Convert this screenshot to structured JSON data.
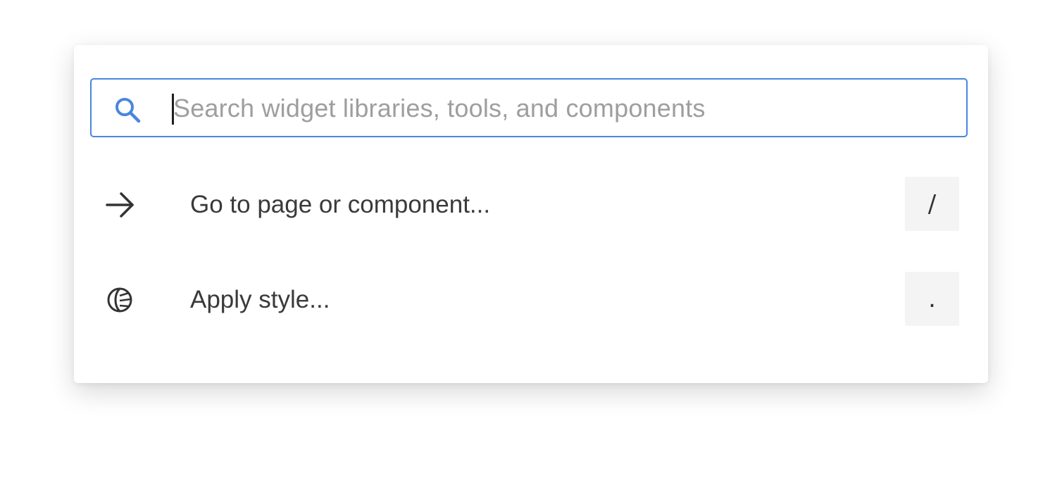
{
  "search": {
    "placeholder": "Search widget libraries, tools, and components",
    "value": ""
  },
  "commands": [
    {
      "icon": "arrow-right-icon",
      "label": "Go to page or component...",
      "shortcut": "/"
    },
    {
      "icon": "style-leaf-icon",
      "label": "Apply style...",
      "shortcut": "."
    }
  ],
  "colors": {
    "accent": "#4a86dd",
    "text": "#3a3a3a",
    "placeholder": "#9e9e9e",
    "kbd_bg": "#f4f4f4"
  }
}
